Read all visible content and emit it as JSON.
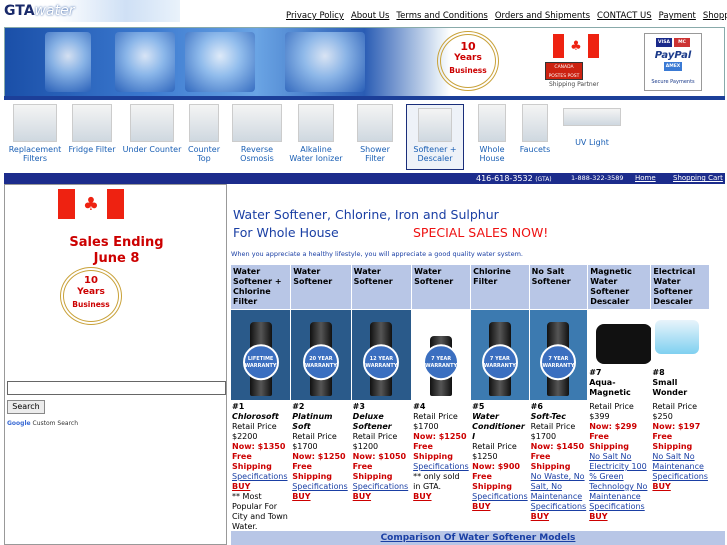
{
  "header": {
    "logo_gta": "GTA",
    "logo_water": "water",
    "links": [
      "Privacy Policy",
      "About Us",
      "Terms and Conditions",
      "Orders and Shipments",
      "CONTACT US",
      "Payment",
      "Shopping Cart"
    ]
  },
  "banner": {
    "award_line1": "10",
    "award_line2": "Years",
    "award_line3": "Business",
    "post_text": "CANADA POSTES POST CANADA",
    "shipping_partner": "Shipping Partner",
    "pay_visa": "VISA",
    "pay_mc": "MC",
    "pay_paypal": "PayPal",
    "pay_amex": "AMEX",
    "secure": "Secure Payments"
  },
  "categories": [
    "Replacement Filters",
    "Fridge Filter",
    "Under Counter",
    "Counter Top",
    "Reverse Osmosis",
    "Alkaline Water Ionizer",
    "Shower Filter",
    "Softener + Descaler",
    "Whole House",
    "Faucets",
    "UV Light"
  ],
  "navbar": {
    "phone": "416-618-3532",
    "phone_suffix": "(GTA)",
    "tollfree": "1-888-322-3589",
    "home": "Home",
    "cart": "Shopping Cart"
  },
  "left": {
    "sales_line1": "Sales Ending",
    "sales_line2": "June 8",
    "award_num": "10",
    "award_years": "Years",
    "award_business": "Business",
    "search_value": "",
    "search_button": "Search",
    "google_logo": "Google",
    "custom_search": "Custom Search"
  },
  "main": {
    "title_line1": "Water Softener, Chlorine, Iron and Sulphur",
    "title_line2": "For Whole House",
    "special": "SPECIAL SALES NOW!",
    "intro": "When you appreciate a healthy lifestyle, you will appreciate a good quality water system.",
    "products": [
      {
        "header": "Water Softener + Chlorine Filter",
        "warranty": "LIFETIME WARRANTY",
        "num": "#1",
        "name": "Chlorosoft",
        "retail": "Retail Price $2200",
        "now": "Now: $1350",
        "ship": "Free Shipping",
        "spec": "Specifications",
        "buy": "BUY",
        "notes": "** Most Popular For City and Town Water."
      },
      {
        "header": "Water Softener",
        "warranty": "20 YEAR WARRANTY",
        "num": "#2",
        "name": "Platinum Soft",
        "retail": "Retail Price $1700",
        "now": "Now: $1250",
        "ship": "Free Shipping",
        "spec": "Specifications",
        "buy": "BUY",
        "notes": ""
      },
      {
        "header": "Water Softener",
        "warranty": "12 YEAR WARRANTY",
        "num": "#3",
        "name": "Deluxe Softener",
        "retail": "Retail Price $1200",
        "now": "Now: $1050",
        "ship": "Free Shipping",
        "spec": "Specifications",
        "buy": "BUY",
        "notes": ""
      },
      {
        "header": "Water Softener",
        "warranty": "7 YEAR WARRANTY",
        "num": "#4",
        "name": "",
        "retail": "Retail Price $1700",
        "now": "Now: $1250",
        "ship": "Free Shipping",
        "spec": "Specifications",
        "buy": "BUY",
        "notes": "** only sold in GTA."
      },
      {
        "header": "Chlorine Filter",
        "warranty": "7 YEAR WARRANTY",
        "num": "#5",
        "name": "Water Conditioner I",
        "retail": "Retail Price $1250",
        "now": "Now: $900",
        "ship": "Free Shipping",
        "spec": "Specifications",
        "buy": "BUY",
        "notes": ""
      },
      {
        "header": "No Salt Softener",
        "warranty": "7 YEAR WARRANTY",
        "num": "#6",
        "name": "Soft-Tec",
        "retail": "Retail Price $1700",
        "now": "Now: $1450",
        "ship": "Free Shipping",
        "spec": "No Waste, No Salt, No Maintenance Specifications",
        "buy": "BUY",
        "notes": ""
      },
      {
        "header": "Magnetic Water Softener Descaler",
        "warranty": "",
        "num": "#7",
        "name": "Aqua-Magnetic",
        "retail": "Retail Price $399",
        "now": "Now: $299",
        "ship": "Free Shipping",
        "spec": "No Salt No Electricity 100 % Green Technology No Maintenance Specifications",
        "buy": "BUY",
        "notes": ""
      },
      {
        "header": "Electrical Water Softener Descaler",
        "warranty": "",
        "num": "#8",
        "name": "Small Wonder",
        "retail": "Retail Price $250",
        "now": "Now: $197",
        "ship": "Free Shipping",
        "spec": "No Salt No Maintenance Specifications",
        "buy": "BUY",
        "notes": ""
      }
    ],
    "compare": "Comparison Of Water Softener Models"
  },
  "colors": {
    "navbar": "#1c2c8c",
    "header_cell": "#b8c6e6",
    "title_blue": "#1a3fa4",
    "sale_red": "#c00"
  }
}
